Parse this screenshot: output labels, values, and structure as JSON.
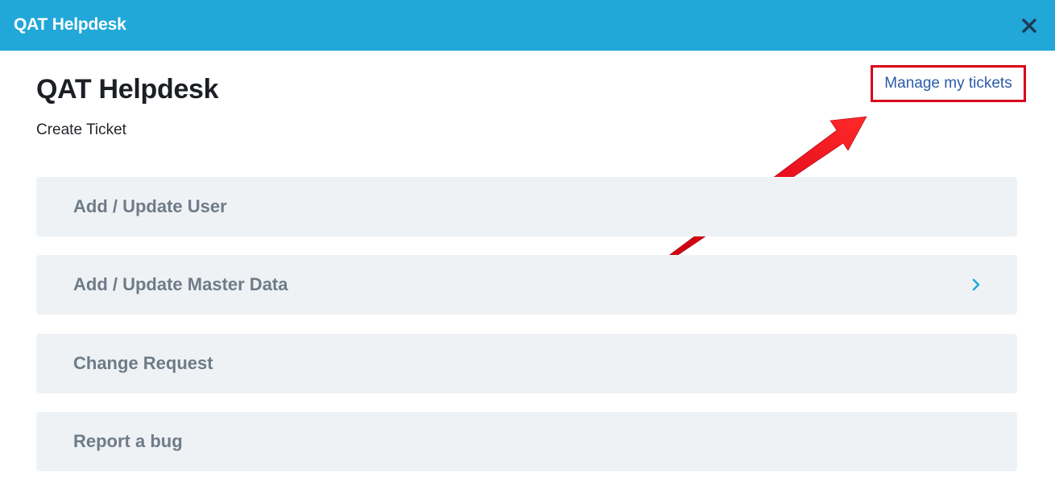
{
  "window": {
    "title": "QAT Helpdesk",
    "accent_color": "#21a8d8"
  },
  "page": {
    "title": "QAT Helpdesk",
    "subtitle": "Create Ticket",
    "manage_link_label": "Manage my tickets"
  },
  "annotation": {
    "highlight_color": "#d9001b"
  },
  "menu": {
    "items": [
      {
        "label": "Add / Update User",
        "has_chevron": false
      },
      {
        "label": "Add / Update Master Data",
        "has_chevron": true
      },
      {
        "label": "Change Request",
        "has_chevron": false
      },
      {
        "label": "Report a bug",
        "has_chevron": false
      }
    ]
  },
  "icons": {
    "close": "close-icon",
    "chevron": "chevron-right-icon"
  }
}
